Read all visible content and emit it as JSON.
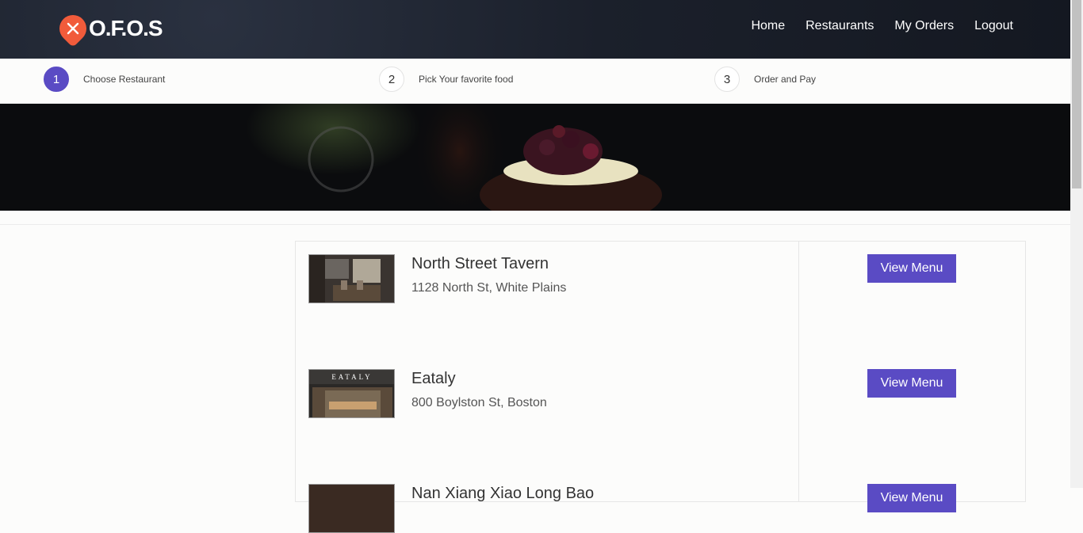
{
  "brand": {
    "name": "O.F.O.S",
    "accent": "#f15b3b"
  },
  "nav": {
    "items": [
      "Home",
      "Restaurants",
      "My Orders",
      "Logout"
    ]
  },
  "steps": [
    {
      "num": "1",
      "label": "Choose Restaurant",
      "active": true
    },
    {
      "num": "2",
      "label": "Pick Your favorite food",
      "active": false
    },
    {
      "num": "3",
      "label": "Order and Pay",
      "active": false
    }
  ],
  "restaurants": [
    {
      "name": "North Street Tavern",
      "address": "1128 North St, White Plains",
      "button": "View Menu"
    },
    {
      "name": "Eataly",
      "address": "800 Boylston St, Boston",
      "button": "View Menu",
      "sign": "EATALY"
    },
    {
      "name": "Nan Xiang Xiao Long Bao",
      "address": "",
      "button": "View Menu"
    }
  ],
  "colors": {
    "primary": "#5a4bc4",
    "navbar": "#1b202b"
  }
}
